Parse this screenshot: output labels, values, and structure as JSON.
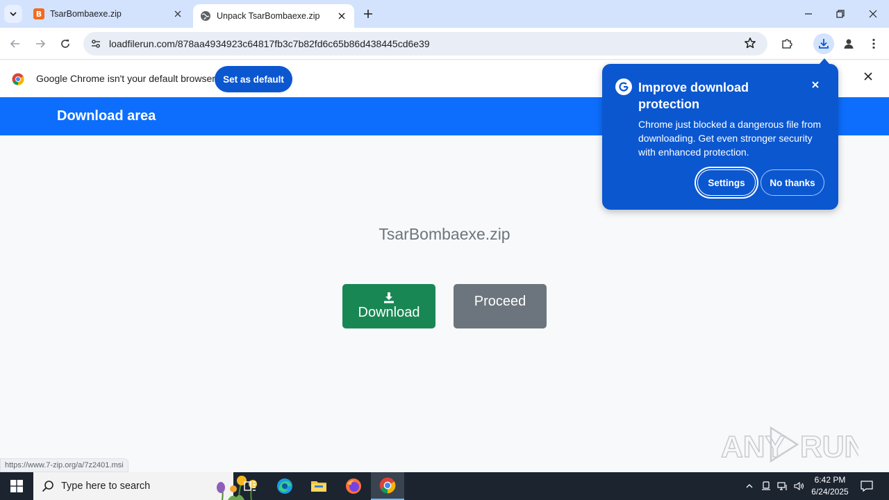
{
  "browser": {
    "tabs": [
      {
        "title": "TsarBombaexe.zip",
        "favicon": "B",
        "active": false
      },
      {
        "title": "Unpack TsarBombaexe.zip",
        "active": true
      }
    ],
    "url": "loadfilerun.com/878aa4934923c64817fb3c7b82fd6c65b86d438445cd6e39"
  },
  "infobar": {
    "message": "Google Chrome isn't your default browser",
    "button": "Set as default"
  },
  "page": {
    "header_title": "Download area",
    "filename": "TsarBombaexe.zip",
    "download_label": "Download",
    "proceed_label": "Proceed",
    "status_url": "https://www.7-zip.org/a/7z2401.msi"
  },
  "popup": {
    "title": "Improve download protection",
    "body": "Chrome just blocked a dangerous file from downloading. Get even stronger security with enhanced protection.",
    "settings_label": "Settings",
    "no_thanks_label": "No thanks"
  },
  "taskbar": {
    "search_placeholder": "Type here to search",
    "time": "6:42 PM",
    "date": "6/24/2025"
  },
  "colors": {
    "header_blue": "#0d6efd",
    "download_green": "#198754",
    "proceed_gray": "#6c757d",
    "popup_blue": "#0b57d0"
  }
}
